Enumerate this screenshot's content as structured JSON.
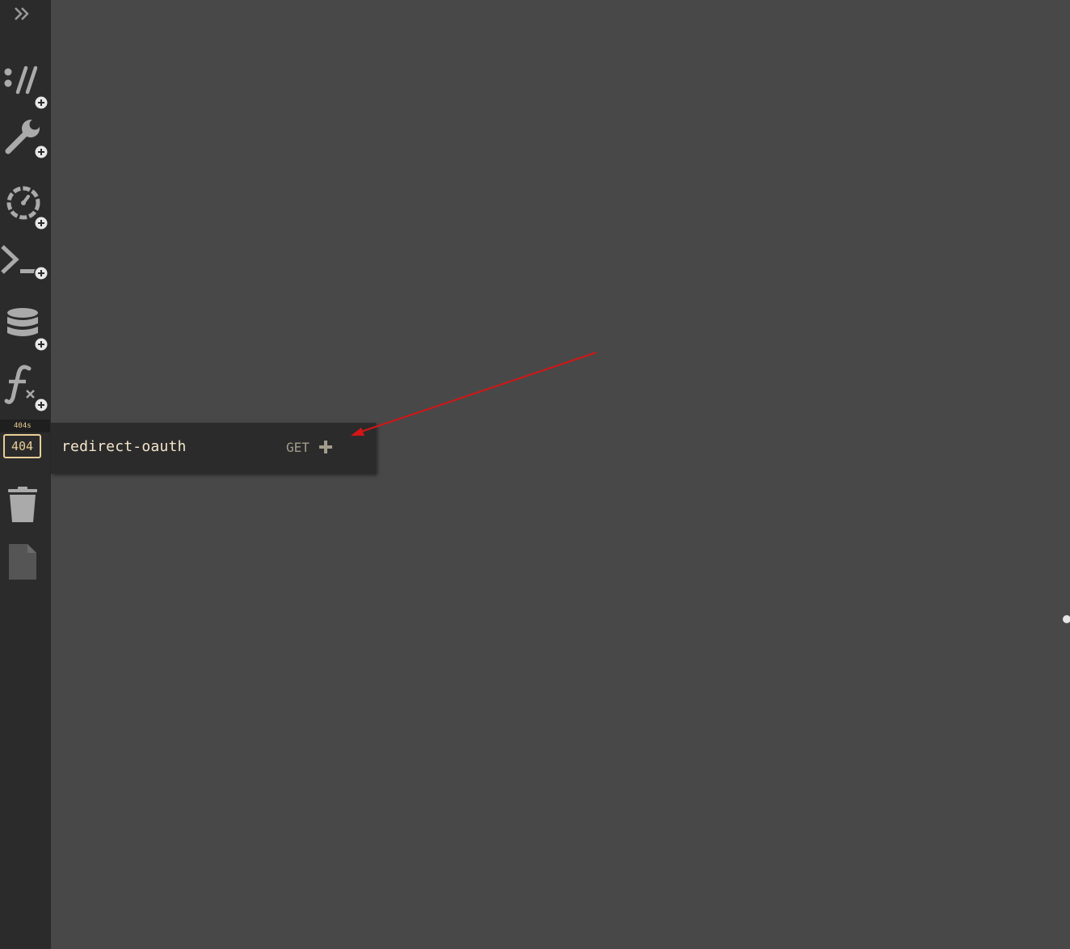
{
  "sidebar": {
    "items": [
      {
        "icon": "double-chevron-right-icon"
      },
      {
        "icon": "http-add-icon"
      },
      {
        "icon": "wrench-add-icon"
      },
      {
        "icon": "cron-add-icon"
      },
      {
        "icon": "repl-add-icon"
      },
      {
        "icon": "database-add-icon"
      },
      {
        "icon": "function-add-icon"
      },
      {
        "icon": "404-icon"
      },
      {
        "icon": "trash-icon"
      },
      {
        "icon": "document-icon"
      }
    ],
    "f404_badge": "404s",
    "f404_label": "404"
  },
  "popup": {
    "route_name": "redirect-oauth",
    "method": "GET"
  },
  "colors": {
    "background": "#484848",
    "sidebar": "#2b2b2b",
    "icon": "#aaaaaa",
    "accent_404": "#e9cf96",
    "arrow": "#d51515"
  }
}
